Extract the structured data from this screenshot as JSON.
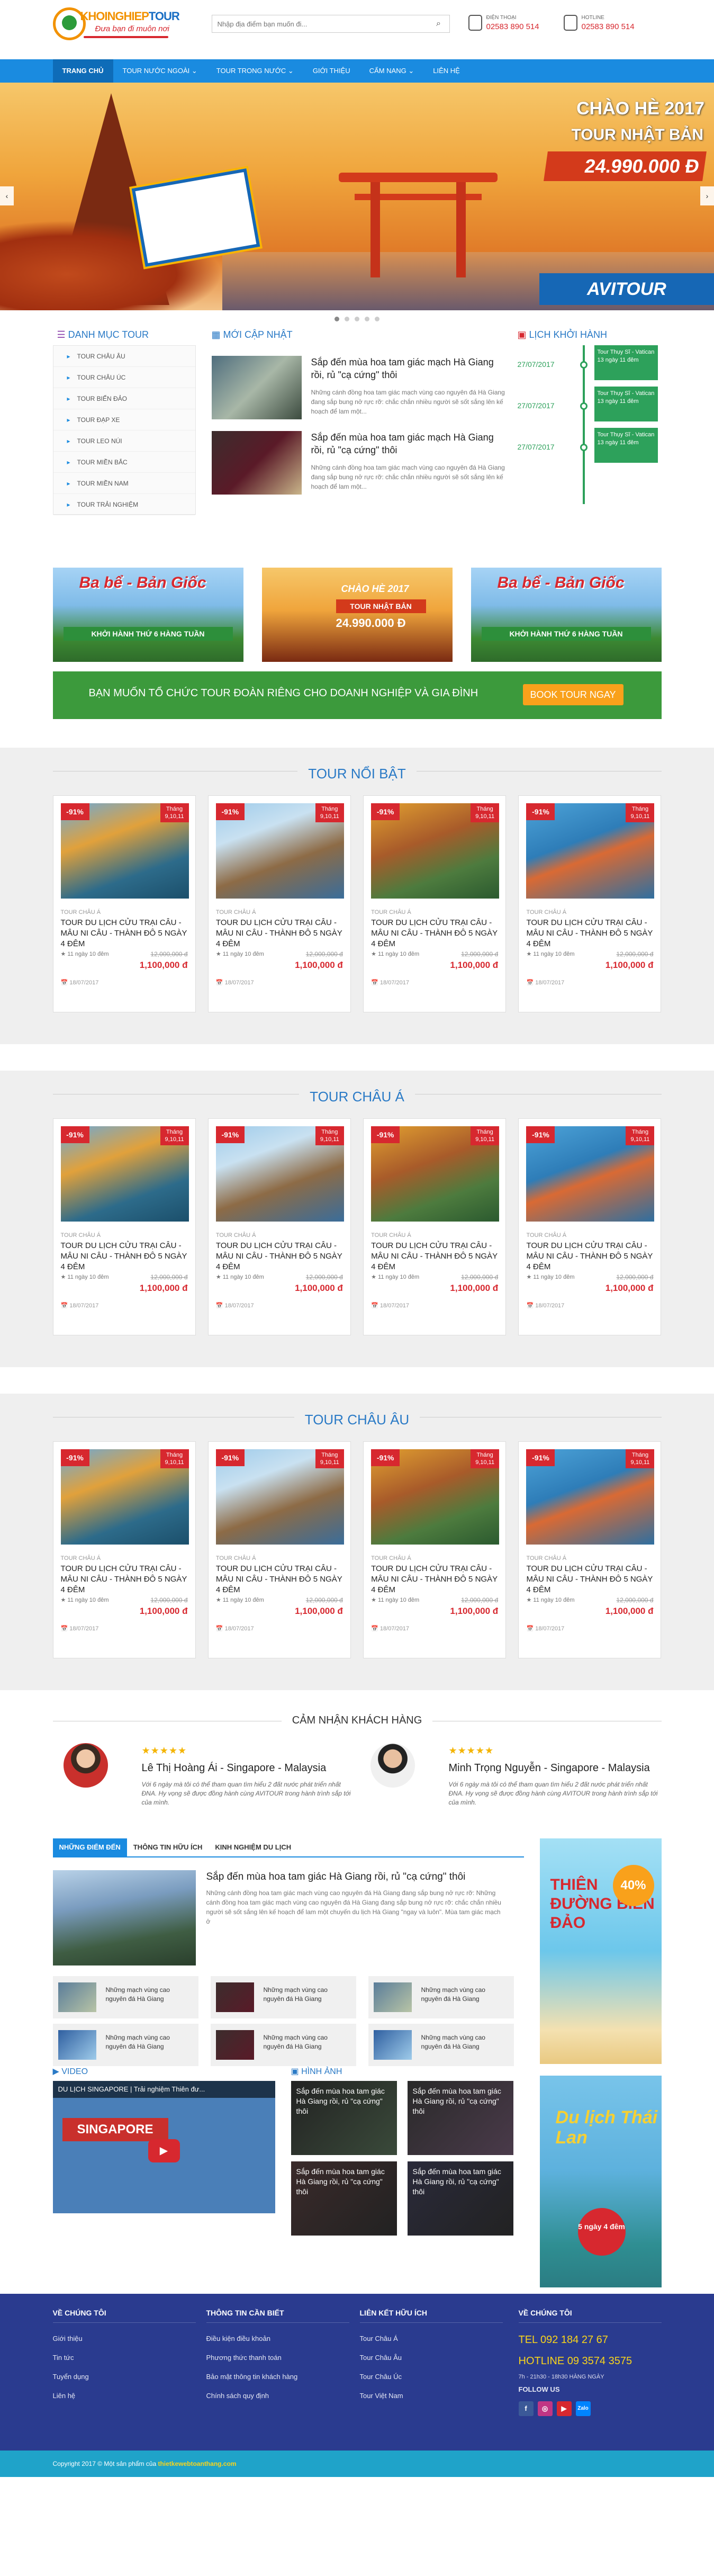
{
  "header": {
    "logo_brand_a": "KHOINGHIEP",
    "logo_brand_b": "TOUR",
    "logo_slogan": "Đưa bạn đi muôn nơi",
    "search_placeholder": "Nhập địa điểm bạn muốn đi...",
    "contact1_label": "ĐIỆN THOẠI",
    "contact1_phone": "02583 890 514",
    "contact2_label": "HOTLINE",
    "contact2_phone": "02583 890 514"
  },
  "nav": [
    "TRANG CHỦ",
    "TOUR NƯỚC NGOÀI ⌄",
    "TOUR TRONG NƯỚC ⌄",
    "GIỚI THIỆU",
    "CẨM NANG ⌄",
    "LIÊN HỆ"
  ],
  "slider": {
    "title1": "CHÀO HÈ 2017",
    "title2": "TOUR NHẬT BẢN",
    "price": "24.990.000 Đ",
    "brand": "AVITOUR"
  },
  "category": {
    "title": "DANH MỤC TOUR",
    "items": [
      "TOUR CHÂU ÂU",
      "TOUR CHÂU ÚC",
      "TOUR BIỂN ĐẢO",
      "TOUR ĐẠP XE",
      "TOUR LEO NÚI",
      "TOUR MIỀN BẮC",
      "TOUR MIỀN NAM",
      "TOUR TRẢI NGHIỆM"
    ]
  },
  "news": {
    "title": "MỚI CẬP NHẬT",
    "items": [
      {
        "title": "Sắp đến mùa hoa tam giác mạch Hà Giang rồi, rủ \"cạ cứng\" thôi",
        "excerpt": "Những cánh đồng hoa tam giác mạch vùng cao nguyên đá Hà Giang đang sắp bung nở rực rỡ: chắc chắn nhiều người sẽ sốt sắng lên kế hoạch để lam một..."
      },
      {
        "title": "Sắp đến mùa hoa tam giác mạch Hà Giang rồi, rủ \"cạ cứng\" thôi",
        "excerpt": "Những cánh đồng hoa tam giác mạch vùng cao nguyên đá Hà Giang đang sắp bung nở rực rỡ: chắc chắn nhiều người sẽ sốt sắng lên kế hoạch để lam một..."
      }
    ]
  },
  "schedule": {
    "title": "LỊCH KHỞI HÀNH",
    "items": [
      {
        "date": "27/07/2017",
        "text": "Tour Thụy Sĩ - Vatican 13 ngày 11 đêm"
      },
      {
        "date": "27/07/2017",
        "text": "Tour Thụy Sĩ - Vatican 13 ngày 11 đêm"
      },
      {
        "date": "27/07/2017",
        "text": "Tour Thụy Sĩ - Vatican 13 ngày 11 đêm"
      }
    ]
  },
  "banners": [
    {
      "title": "Ba bể - Bản Giốc",
      "sub": "KHỞI HÀNH THỨ 6 HÀNG TUẦN"
    },
    {
      "title": "CHÀO HÈ 2017",
      "sub": "TOUR NHẬT BẢN",
      "price": "24.990.000 Đ"
    },
    {
      "title": "Ba bể - Bản Giốc",
      "sub": "KHỞI HÀNH THỨ 6 HÀNG TUẦN"
    }
  ],
  "cta": {
    "text": "BẠN MUỐN TỔ CHỨC TOUR ĐOÀN RIÊNG CHO DOANH NGHIỆP VÀ GIA ĐÌNH",
    "button": "BOOK TOUR NGAY"
  },
  "sections": [
    {
      "title": "TOUR NỔI BẬT",
      "cards": [
        {
          "cat": "TOUR CHÂU Á",
          "name": "TOUR DU LỊCH CỬU TRẠI CÂU - MÂU NI CÂU - THÀNH ĐÔ 5 NGÀY 4 ĐÊM",
          "dur": "★ 11 ngày 10 đêm",
          "old": "12,000,000 đ",
          "new": "1,100,000 đ",
          "date": "📅 18/07/2017",
          "sale": "-91%",
          "month": "Tháng 9,10,11"
        },
        {
          "cat": "TOUR CHÂU Á",
          "name": "TOUR DU LỊCH CỬU TRẠI CÂU - MÂU NI CÂU - THÀNH ĐÔ 5 NGÀY 4 ĐÊM",
          "dur": "★ 11 ngày 10 đêm",
          "old": "12,000,000 đ",
          "new": "1,100,000 đ",
          "date": "📅 18/07/2017",
          "sale": "-91%",
          "month": "Tháng 9,10,11"
        },
        {
          "cat": "TOUR CHÂU Á",
          "name": "TOUR DU LỊCH CỬU TRẠI CÂU - MÂU NI CÂU - THÀNH ĐÔ 5 NGÀY 4 ĐÊM",
          "dur": "★ 11 ngày 10 đêm",
          "old": "12,000,000 đ",
          "new": "1,100,000 đ",
          "date": "📅 18/07/2017",
          "sale": "-91%",
          "month": "Tháng 9,10,11"
        },
        {
          "cat": "TOUR CHÂU Á",
          "name": "TOUR DU LỊCH CỬU TRẠI CÂU - MÂU NI CÂU - THÀNH ĐÔ 5 NGÀY 4 ĐÊM",
          "dur": "★ 11 ngày 10 đêm",
          "old": "12,000,000 đ",
          "new": "1,100,000 đ",
          "date": "📅 18/07/2017",
          "sale": "-91%",
          "month": "Tháng 9,10,11"
        }
      ]
    },
    {
      "title": "TOUR CHÂU Á",
      "cards": [
        {
          "cat": "TOUR CHÂU Á",
          "name": "TOUR DU LỊCH CỬU TRẠI CÂU - MÂU NI CÂU - THÀNH ĐÔ 5 NGÀY 4 ĐÊM",
          "dur": "★ 11 ngày 10 đêm",
          "old": "12,000,000 đ",
          "new": "1,100,000 đ",
          "date": "📅 18/07/2017",
          "sale": "-91%",
          "month": "Tháng 9,10,11"
        },
        {
          "cat": "TOUR CHÂU Á",
          "name": "TOUR DU LỊCH CỬU TRẠI CÂU - MÂU NI CÂU - THÀNH ĐÔ 5 NGÀY 4 ĐÊM",
          "dur": "★ 11 ngày 10 đêm",
          "old": "12,000,000 đ",
          "new": "1,100,000 đ",
          "date": "📅 18/07/2017",
          "sale": "-91%",
          "month": "Tháng 9,10,11"
        },
        {
          "cat": "TOUR CHÂU Á",
          "name": "TOUR DU LỊCH CỬU TRẠI CÂU - MÂU NI CÂU - THÀNH ĐÔ 5 NGÀY 4 ĐÊM",
          "dur": "★ 11 ngày 10 đêm",
          "old": "12,000,000 đ",
          "new": "1,100,000 đ",
          "date": "📅 18/07/2017",
          "sale": "-91%",
          "month": "Tháng 9,10,11"
        },
        {
          "cat": "TOUR CHÂU Á",
          "name": "TOUR DU LỊCH CỬU TRẠI CÂU - MÂU NI CÂU - THÀNH ĐÔ 5 NGÀY 4 ĐÊM",
          "dur": "★ 11 ngày 10 đêm",
          "old": "12,000,000 đ",
          "new": "1,100,000 đ",
          "date": "📅 18/07/2017",
          "sale": "-91%",
          "month": "Tháng 9,10,11"
        }
      ]
    },
    {
      "title": "TOUR CHÂU ÂU",
      "cards": [
        {
          "cat": "TOUR CHÂU Á",
          "name": "TOUR DU LỊCH CỬU TRẠI CÂU - MÂU NI CÂU - THÀNH ĐÔ 5 NGÀY 4 ĐÊM",
          "dur": "★ 11 ngày 10 đêm",
          "old": "12,000,000 đ",
          "new": "1,100,000 đ",
          "date": "📅 18/07/2017",
          "sale": "-91%",
          "month": "Tháng 9,10,11"
        },
        {
          "cat": "TOUR CHÂU Á",
          "name": "TOUR DU LỊCH CỬU TRẠI CÂU - MÂU NI CÂU - THÀNH ĐÔ 5 NGÀY 4 ĐÊM",
          "dur": "★ 11 ngày 10 đêm",
          "old": "12,000,000 đ",
          "new": "1,100,000 đ",
          "date": "📅 18/07/2017",
          "sale": "-91%",
          "month": "Tháng 9,10,11"
        },
        {
          "cat": "TOUR CHÂU Á",
          "name": "TOUR DU LỊCH CỬU TRẠI CÂU - MÂU NI CÂU - THÀNH ĐÔ 5 NGÀY 4 ĐÊM",
          "dur": "★ 11 ngày 10 đêm",
          "old": "12,000,000 đ",
          "new": "1,100,000 đ",
          "date": "📅 18/07/2017",
          "sale": "-91%",
          "month": "Tháng 9,10,11"
        },
        {
          "cat": "TOUR CHÂU Á",
          "name": "TOUR DU LỊCH CỬU TRẠI CÂU - MÂU NI CÂU - THÀNH ĐÔ 5 NGÀY 4 ĐÊM",
          "dur": "★ 11 ngày 10 đêm",
          "old": "12,000,000 đ",
          "new": "1,100,000 đ",
          "date": "📅 18/07/2017",
          "sale": "-91%",
          "month": "Tháng 9,10,11"
        }
      ]
    }
  ],
  "testimonials": {
    "title": "CẢM NHẬN KHÁCH HÀNG",
    "items": [
      {
        "stars": "★★★★★",
        "name": "Lê Thị Hoàng Ái - Singapore - Malaysia",
        "text": "Với 6 ngày mà tôi có thể tham quan tìm hiểu 2 đất nước phát triển nhất ĐNA. Hy vọng sẽ được đồng hành cùng AVITOUR trong hành trình sắp tới của mình."
      },
      {
        "stars": "★★★★★",
        "name": "Minh Trọng Nguyễn - Singapore - Malaysia",
        "text": "Với 6 ngày mà tôi có thể tham quan tìm hiểu 2 đất nước phát triển nhất ĐNA. Hy vọng sẽ được đồng hành cùng AVITOUR trong hành trình sắp tới của mình."
      }
    ]
  },
  "info": {
    "tabs": [
      "NHỮNG ĐIỂM ĐẾN",
      "THÔNG TIN HỮU ÍCH",
      "KINH NGHIỆM DU LỊCH"
    ],
    "feature_title": "Sắp đến mùa hoa tam giác Hà Giang rồi, rủ \"cạ cứng\" thôi",
    "feature_excerpt": "Những cánh đồng hoa tam giác mạch vùng cao nguyên đá Hà Giang đang sắp bung nở rực rỡ: Những cánh đồng hoa tam giác mạch vùng cao nguyên đá Hà Giang đang sắp bung nở rực rỡ: chắc chắn nhiều người sẽ sốt sắng lên kế hoạch để lam một chuyến du lịch Hà Giang \"ngay và luôn\". Mùa tam giác mạch ở",
    "mini": [
      "Những mạch vùng cao nguyên đá Hà Giang",
      "Những mạch vùng cao nguyên đá Hà Giang",
      "Những mạch vùng cao nguyên đá Hà Giang",
      "Những mạch vùng cao nguyên đá Hà Giang",
      "Những mạch vùng cao nguyên đá Hà Giang",
      "Những mạch vùng cao nguyên đá Hà Giang"
    ],
    "video_title": "VIDEO",
    "video_caption": "DU LỊCH SINGAPORE | Trải nghiệm Thiên đư...",
    "video_sign": "SINGAPORE",
    "photos_title": "HÌNH ẢNH",
    "photos": [
      "Sắp đến mùa hoa tam giác Hà Giang rồi, rủ \"cạ cứng\" thôi",
      "Sắp đến mùa hoa tam giác Hà Giang rồi, rủ \"cạ cứng\" thôi",
      "Sắp đến mùa hoa tam giác Hà Giang rồi, rủ \"cạ cứng\" thôi",
      "Sắp đến mùa hoa tam giác Hà Giang rồi, rủ \"cạ cứng\" thôi"
    ],
    "ad1_title": "THIÊN ĐƯỜNG BIỂN ĐẢO",
    "ad1_badge": "40%",
    "ad2_title": "Du lịch Thái Lan",
    "ad2_badge": "5 ngày 4 đêm"
  },
  "footer": {
    "col1_title": "VỀ CHÚNG TÔI",
    "col1": [
      "Giới thiệu",
      "Tin tức",
      "Tuyển dụng",
      "Liên hệ"
    ],
    "col2_title": "THÔNG TIN CẦN BIẾT",
    "col2": [
      "Điều kiện điều khoản",
      "Phương thức thanh toán",
      "Bảo mật thông tin khách hàng",
      "Chính sách quy định"
    ],
    "col3_title": "LIÊN KẾT HỮU ÍCH",
    "col3": [
      "Tour Châu Á",
      "Tour Châu Âu",
      "Tour Châu Úc",
      "Tour Việt Nam"
    ],
    "col4_title": "VỀ CHÚNG TÔI",
    "tel": "TEL 092 184 27 67",
    "hotline": "HOTLINE 09 3574 3575",
    "hours": "7h - 21h30 - 18h30 HÀNG NGÀY",
    "follow": "FOLLOW US",
    "copyright": "Copyright 2017 © Một sản phẩm của",
    "copyright_link": "thietkewebtoanthang.com"
  },
  "colors": {
    "primary": "#1a8be0",
    "accent_red": "#d7282f",
    "green": "#3c9a3c",
    "footer": "#2a3b8f"
  }
}
